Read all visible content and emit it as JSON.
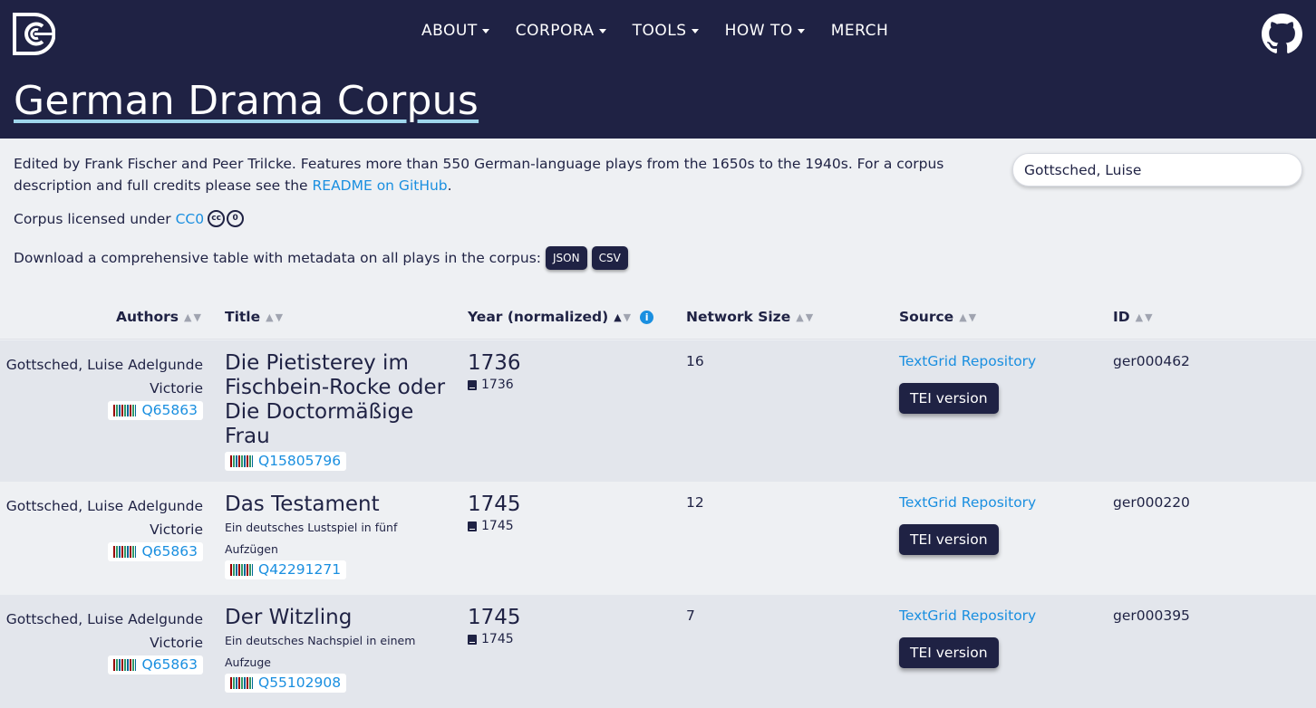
{
  "nav": {
    "items": [
      {
        "label": "ABOUT",
        "dropdown": true
      },
      {
        "label": "CORPORA",
        "dropdown": true
      },
      {
        "label": "TOOLS",
        "dropdown": true
      },
      {
        "label": "HOW TO",
        "dropdown": true
      },
      {
        "label": "MERCH",
        "dropdown": false
      }
    ]
  },
  "page": {
    "title": "German Drama Corpus",
    "intro_text": "Edited by Frank Fischer and Peer Trilcke. Features more than 550 German-language plays from the 1650s to the 1940s. For a corpus description and full credits please see the ",
    "intro_link": "README on GitHub",
    "intro_end": ".",
    "license_text": "Corpus licensed under ",
    "license_link": "CC0",
    "download_text": "Download a comprehensive table with metadata on all plays in the corpus:",
    "download_json": "JSON",
    "download_csv": "CSV"
  },
  "search": {
    "value": "Gottsched, Luise"
  },
  "table": {
    "headers": {
      "authors": "Authors",
      "title": "Title",
      "year": "Year (normalized)",
      "network": "Network Size",
      "source": "Source",
      "id": "ID"
    },
    "sort_arrows": {
      "up": "▲",
      "down": "▼"
    },
    "rows": [
      {
        "author": "Gottsched, Luise Adelgunde Victorie",
        "author_wd": "Q65863",
        "title": "Die Pietisterey im Fischbein-Rocke oder Die Doctormäßige Frau",
        "subtitle": "",
        "title_wd": "Q15805796",
        "year": "1736",
        "year_printed": "1736",
        "network_size": "16",
        "source": "TextGrid Repository",
        "tei": "TEI version",
        "id": "ger000462"
      },
      {
        "author": "Gottsched, Luise Adelgunde Victorie",
        "author_wd": "Q65863",
        "title": "Das Testament",
        "subtitle": "Ein deutsches Lustspiel in fünf Aufzügen",
        "title_wd": "Q42291271",
        "year": "1745",
        "year_printed": "1745",
        "network_size": "12",
        "source": "TextGrid Repository",
        "tei": "TEI version",
        "id": "ger000220"
      },
      {
        "author": "Gottsched, Luise Adelgunde Victorie",
        "author_wd": "Q65863",
        "title": "Der Witzling",
        "subtitle": "Ein deutsches Nachspiel in einem Aufzuge",
        "title_wd": "Q55102908",
        "year": "1745",
        "year_printed": "1745",
        "network_size": "7",
        "source": "TextGrid Repository",
        "tei": "TEI version",
        "id": "ger000395"
      }
    ]
  },
  "colors": {
    "header_bg": "#1f2244",
    "link": "#1a8fe0",
    "row_alt": "#e3e6ec",
    "page_bg": "#eef0f3"
  }
}
